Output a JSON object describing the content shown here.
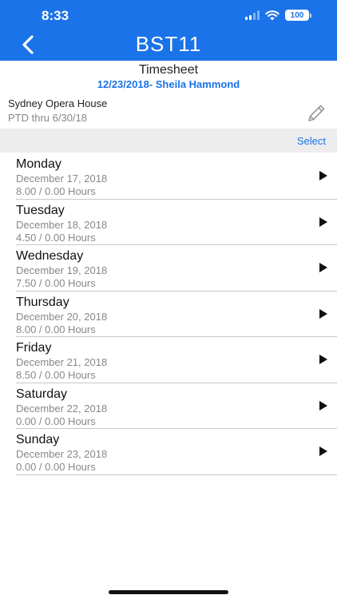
{
  "status_bar": {
    "time": "8:33",
    "battery": "100"
  },
  "nav": {
    "title": "BST11"
  },
  "timesheet": {
    "title": "Timesheet",
    "subtitle": "12/23/2018- Sheila Hammond"
  },
  "project": {
    "name": "Sydney Opera House",
    "ptd": "PTD thru 6/30/18"
  },
  "toolbar": {
    "select_label": "Select"
  },
  "days": [
    {
      "name": "Monday",
      "date": "December 17, 2018",
      "hours": "8.00 / 0.00 Hours"
    },
    {
      "name": "Tuesday",
      "date": "December 18, 2018",
      "hours": "4.50 / 0.00 Hours"
    },
    {
      "name": "Wednesday",
      "date": "December 19, 2018",
      "hours": "7.50 / 0.00 Hours"
    },
    {
      "name": "Thursday",
      "date": "December 20, 2018",
      "hours": "8.00 / 0.00 Hours"
    },
    {
      "name": "Friday",
      "date": "December 21, 2018",
      "hours": "8.50 / 0.00 Hours"
    },
    {
      "name": "Saturday",
      "date": "December 22, 2018",
      "hours": "0.00 / 0.00 Hours"
    },
    {
      "name": "Sunday",
      "date": "December 23, 2018",
      "hours": "0.00 / 0.00 Hours"
    }
  ],
  "icons": {
    "back": "chevron-left-icon",
    "edit": "pencil-icon",
    "row_action": "play-triangle-icon",
    "signal": "cellular-signal-icon",
    "wifi": "wifi-icon",
    "battery": "battery-icon"
  },
  "colors": {
    "accent": "#1a73e8",
    "select_bar": "#ededed",
    "divider": "#c8c8c8"
  }
}
